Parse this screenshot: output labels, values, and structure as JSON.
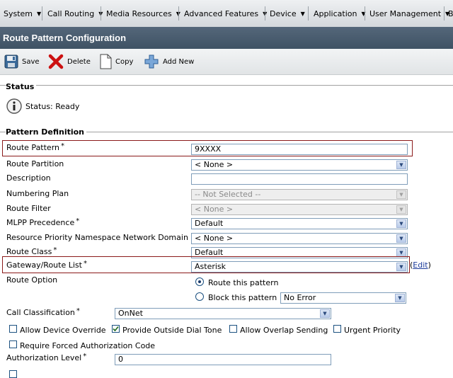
{
  "menubar": {
    "items": [
      {
        "label": "System"
      },
      {
        "label": "Call Routing"
      },
      {
        "label": "Media Resources"
      },
      {
        "label": "Advanced Features"
      },
      {
        "label": "Device"
      },
      {
        "label": "Application"
      },
      {
        "label": "User Management"
      },
      {
        "label": "B"
      }
    ]
  },
  "page": {
    "title": "Route Pattern Configuration"
  },
  "toolbar": {
    "save_label": "Save",
    "delete_label": "Delete",
    "copy_label": "Copy",
    "add_new_label": "Add New"
  },
  "status": {
    "section_title": "Status",
    "text": "Status: Ready",
    "icon": "info-icon"
  },
  "pattern_definition": {
    "section_title": "Pattern Definition",
    "route_pattern": {
      "label": "Route Pattern",
      "required": "*",
      "value": "9XXXX"
    },
    "route_partition": {
      "label": "Route Partition",
      "value": "< None >"
    },
    "description": {
      "label": "Description",
      "value": ""
    },
    "numbering_plan": {
      "label": "Numbering Plan",
      "value": "-- Not Selected --"
    },
    "route_filter": {
      "label": "Route Filter",
      "value": "< None >"
    },
    "mlpp_precedence": {
      "label": "MLPP Precedence",
      "required": "*",
      "value": "Default"
    },
    "resource_priority": {
      "label": "Resource Priority Namespace Network Domain",
      "value": "< None >"
    },
    "route_class": {
      "label": "Route Class",
      "required": "*",
      "value": "Default"
    },
    "gateway_route_list": {
      "label": "Gateway/Route List",
      "required": "*",
      "value": "Asterisk",
      "edit_open": "(",
      "edit_link": "Edit",
      "edit_close": ")"
    },
    "route_option": {
      "label": "Route Option",
      "route_this_pattern": "Route this pattern",
      "block_this_pattern": "Block this pattern",
      "block_reason": "No Error"
    },
    "call_classification": {
      "label": "Call Classification",
      "required": "*",
      "value": "OnNet"
    },
    "allow_device_override": {
      "label": "Allow Device Override",
      "checked": false
    },
    "provide_outside_dial_tone": {
      "label": "Provide Outside Dial Tone",
      "checked": true
    },
    "allow_overlap_sending": {
      "label": "Allow Overlap Sending",
      "checked": false
    },
    "urgent_priority": {
      "label": "Urgent Priority",
      "checked": false
    },
    "require_forced_auth": {
      "label": "Require Forced Authorization Code",
      "checked": false
    },
    "authorization_level": {
      "label": "Authorization Level",
      "required": "*",
      "value": "0"
    }
  },
  "colors": {
    "title_bar": "#4a5d70",
    "highlight_box": "#8b1a1a",
    "link": "#1a3a9a"
  }
}
